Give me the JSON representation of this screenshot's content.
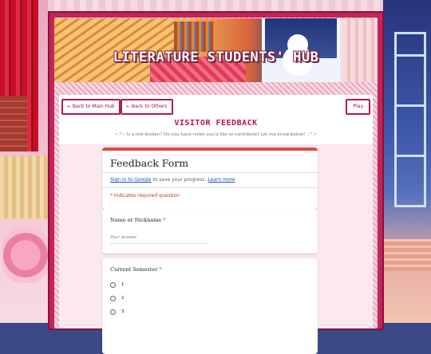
{
  "banner": {
    "title": "LITERATURE STUDENTS' HUB"
  },
  "nav": {
    "back_main": "← Back to Main Hub",
    "back_others": "← Back to Others",
    "play": "Play"
  },
  "section": {
    "heading": "VISITOR FEEDBACK",
    "subline": "•.°♡ Is a link broken? Do you have notes you'd like to contribute? Let me know below! ♡°.•"
  },
  "form": {
    "title": "Feedback Form",
    "signin_link": "Sign in to Google",
    "signin_text": " to save your progress. ",
    "learn_more": "Learn more",
    "required_note": "* Indicates required question",
    "questions": [
      {
        "label": "Name or Nickname",
        "required_mark": "*",
        "placeholder": "Your answer"
      },
      {
        "label": "Current Semester",
        "required_mark": "*",
        "options": [
          "1",
          "2",
          "3"
        ]
      }
    ]
  },
  "colors": {
    "accent": "#c0124b",
    "panel_frame": "#c3245a",
    "form_header": "#e04a45",
    "link": "#1a4fb8",
    "required": "#d93025"
  }
}
